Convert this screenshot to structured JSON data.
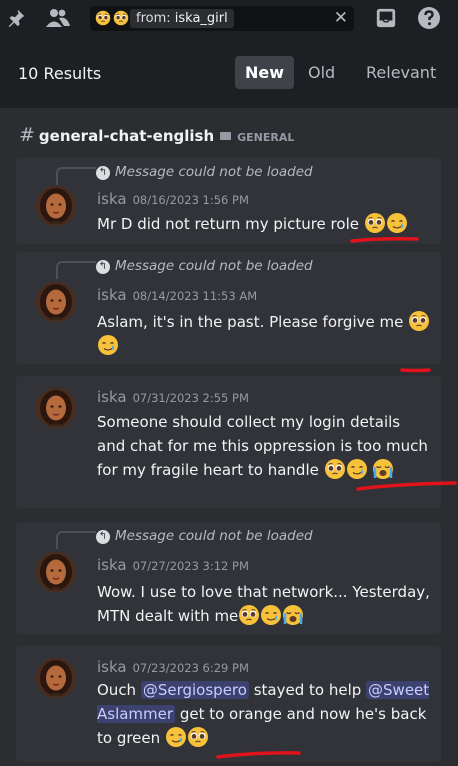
{
  "search": {
    "filter_prefix": "from:",
    "filter_value": "iska_girl",
    "clear_glyph": "✕"
  },
  "results": {
    "count_label": "10 Results",
    "sort": [
      "New",
      "Old",
      "Relevant"
    ],
    "active_sort": "New"
  },
  "channel": {
    "name": "general-chat-english",
    "category": "GENERAL"
  },
  "messages": [
    {
      "reply_text": "Message could not be loaded",
      "author": "iska",
      "timestamp": "08/16/2023 1:56 PM",
      "text": "Mr D did not return my picture role",
      "emojis": [
        "pleading-face",
        "smiling-tear-face"
      ]
    },
    {
      "reply_text": "Message could not be loaded",
      "author": "iska",
      "timestamp": "08/14/2023 11:53 AM",
      "text": "Aslam, it's in the past. Please forgive me",
      "emojis": [
        "pleading-face",
        "smiling-tear-face"
      ]
    },
    {
      "author": "iska",
      "timestamp": "07/31/2023 2:55 PM",
      "text": "Someone should collect my login details and chat for me this oppression is too much for my fragile heart to handle",
      "emojis": [
        "pleading-face",
        "smiling-tear-face",
        "loudly-crying-face"
      ]
    },
    {
      "reply_text": "Message could not be loaded",
      "author": "iska",
      "timestamp": "07/27/2023 3:12 PM",
      "text": "Wow. I use to love that network... Yesterday, MTN dealt with me",
      "emojis": [
        "pleading-face",
        "smiling-tear-face",
        "loudly-crying-face"
      ]
    },
    {
      "author": "iska",
      "timestamp": "07/23/2023 6:29 PM",
      "text_before": "Ouch ",
      "mention_1": "@Sergiospero",
      "text_middle": " stayed to help ",
      "mention_2": "@Sweet Aslammer",
      "text_after": " get to orange and now he's back to green",
      "emojis": [
        "smiling-tear-face",
        "pleading-face"
      ]
    }
  ],
  "colors": {
    "annotation": "#e0121b",
    "mention_bg": "#3c4270",
    "panel": "#2b2d31",
    "card": "#313338"
  }
}
